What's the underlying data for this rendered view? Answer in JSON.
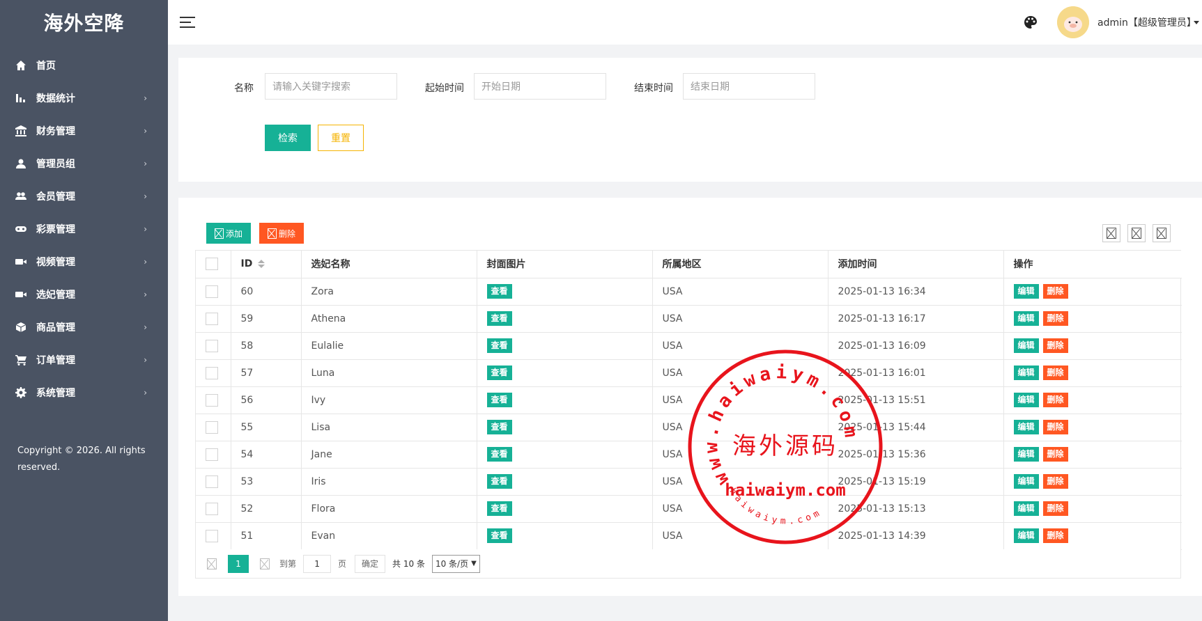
{
  "app": {
    "logo": "海外空降"
  },
  "sidebar": {
    "items": [
      {
        "label": "首页",
        "icon": "home-icon",
        "has_children": false
      },
      {
        "label": "数据统计",
        "icon": "bar-chart-icon",
        "has_children": true
      },
      {
        "label": "财务管理",
        "icon": "bank-icon",
        "has_children": true
      },
      {
        "label": "管理员组",
        "icon": "user-icon",
        "has_children": true
      },
      {
        "label": "会员管理",
        "icon": "users-icon",
        "has_children": true
      },
      {
        "label": "彩票管理",
        "icon": "gamepad-icon",
        "has_children": true
      },
      {
        "label": "视频管理",
        "icon": "video-icon",
        "has_children": true
      },
      {
        "label": "选妃管理",
        "icon": "video-icon",
        "has_children": true
      },
      {
        "label": "商品管理",
        "icon": "box-icon",
        "has_children": true
      },
      {
        "label": "订单管理",
        "icon": "cart-icon",
        "has_children": true
      },
      {
        "label": "系统管理",
        "icon": "gear-icon",
        "has_children": true
      }
    ],
    "copyright": "Copyright © 2026. All rights reserved."
  },
  "header": {
    "user": "admin【超级管理员】"
  },
  "search": {
    "name_label": "名称",
    "name_placeholder": "请输入关键字搜索",
    "start_label": "起始时间",
    "start_placeholder": "开始日期",
    "end_label": "结束时间",
    "end_placeholder": "结束日期",
    "search_button": "检索",
    "reset_button": "重置"
  },
  "toolbar": {
    "add_label": "添加",
    "delete_label": "删除"
  },
  "table": {
    "columns": [
      "ID",
      "选妃名称",
      "封面图片",
      "所属地区",
      "添加时间",
      "操作"
    ],
    "view_label": "查看",
    "edit_label": "编辑",
    "delete_label": "删除",
    "rows": [
      {
        "id": "60",
        "name": "Zora",
        "region": "USA",
        "time": "2025-01-13 16:34"
      },
      {
        "id": "59",
        "name": "Athena",
        "region": "USA",
        "time": "2025-01-13 16:17"
      },
      {
        "id": "58",
        "name": "Eulalie",
        "region": "USA",
        "time": "2025-01-13 16:09"
      },
      {
        "id": "57",
        "name": "Luna",
        "region": "USA",
        "time": "2025-01-13 16:01"
      },
      {
        "id": "56",
        "name": "Ivy",
        "region": "USA",
        "time": "2025-01-13 15:51"
      },
      {
        "id": "55",
        "name": "Lisa",
        "region": "USA",
        "time": "2025-01-13 15:44"
      },
      {
        "id": "54",
        "name": "Jane",
        "region": "USA",
        "time": "2025-01-13 15:36"
      },
      {
        "id": "53",
        "name": "Iris",
        "region": "USA",
        "time": "2025-01-13 15:19"
      },
      {
        "id": "52",
        "name": "Flora",
        "region": "USA",
        "time": "2025-01-13 15:13"
      },
      {
        "id": "51",
        "name": "Evan",
        "region": "USA",
        "time": "2025-01-13 14:39"
      }
    ]
  },
  "pager": {
    "current_page": "1",
    "goto_label": "到第",
    "goto_value": "1",
    "page_unit": "页",
    "confirm": "确定",
    "total": "共 10 条",
    "page_size": "10 条/页"
  },
  "watermark": {
    "ring_text": "www.haiwaiym.com",
    "center_text": "海外源码",
    "domain_text": "haiwaiym.com",
    "small_text": "haiwaiym.com"
  },
  "colors": {
    "sidebar_bg": "#4a5363",
    "primary": "#16b196",
    "danger": "#ff5722",
    "warning": "#f5b301",
    "stamp": "#e8141c"
  }
}
